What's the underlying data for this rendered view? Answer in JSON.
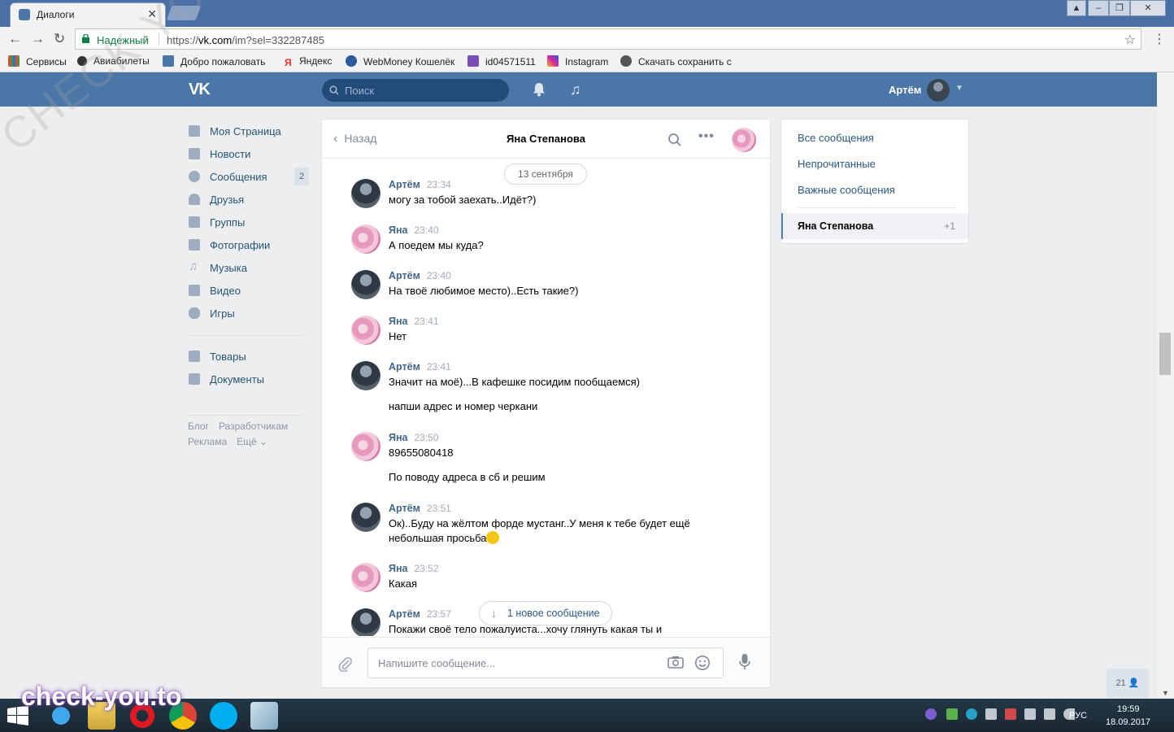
{
  "browser": {
    "tab_title": "Диалоги",
    "tab_close": "✕",
    "secure_label": "Надежный",
    "url_scheme": "https://",
    "url_host": "vk.com",
    "url_path": "/im?sel=332287485",
    "bookmarks": [
      "Сервисы",
      "Авиабилеты",
      "Добро пожаловать",
      "Яндекс",
      "WebMoney Кошелёк",
      "id04571511",
      "Instagram",
      "Скачать сохранить с"
    ]
  },
  "header": {
    "logo": "VK",
    "search_placeholder": "Поиск",
    "user_name": "Артём"
  },
  "nav": {
    "items": [
      {
        "label": "Моя Страница",
        "icon": "home-icon"
      },
      {
        "label": "Новости",
        "icon": "news-icon"
      },
      {
        "label": "Сообщения",
        "icon": "messages-icon",
        "badge": "2"
      },
      {
        "label": "Друзья",
        "icon": "friends-icon"
      },
      {
        "label": "Группы",
        "icon": "groups-icon"
      },
      {
        "label": "Фотографии",
        "icon": "photos-icon"
      },
      {
        "label": "Музыка",
        "icon": "music-icon"
      },
      {
        "label": "Видео",
        "icon": "video-icon"
      },
      {
        "label": "Игры",
        "icon": "games-icon"
      }
    ],
    "secondary": [
      {
        "label": "Товары",
        "icon": "market-icon"
      },
      {
        "label": "Документы",
        "icon": "documents-icon"
      }
    ],
    "footer": [
      "Блог",
      "Разработчикам",
      "Реклама",
      "Ещё ⌄"
    ]
  },
  "chat": {
    "back_label": "Назад",
    "title": "Яна Степанова",
    "date_divider": "13 сентября",
    "messages": [
      {
        "author": "Артём",
        "time": "23:34",
        "avatar": "artem",
        "lines": [
          "могу за тобой заехать..Идёт?)"
        ]
      },
      {
        "author": "Яна",
        "time": "23:40",
        "avatar": "yana",
        "lines": [
          "А поедем мы куда?"
        ]
      },
      {
        "author": "Артём",
        "time": "23:40",
        "avatar": "artem",
        "lines": [
          "На твоё любимое место)..Есть такие?)"
        ]
      },
      {
        "author": "Яна",
        "time": "23:41",
        "avatar": "yana",
        "lines": [
          "Нет"
        ]
      },
      {
        "author": "Артём",
        "time": "23:41",
        "avatar": "artem",
        "lines": [
          "Значит на моё)...В кафешке посидим пообщаемся)",
          "напши адрес и номер черкани"
        ]
      },
      {
        "author": "Яна",
        "time": "23:50",
        "avatar": "yana",
        "lines": [
          "89655080418",
          "По поводу адреса в сб и решим"
        ]
      },
      {
        "author": "Артём",
        "time": "23:51",
        "avatar": "artem",
        "lines": [
          "Ок)..Буду на жёлтом форде мустанг..У меня к тебе будет ещё небольшая просьба"
        ]
      },
      {
        "author": "Яна",
        "time": "23:52",
        "avatar": "yana",
        "lines": [
          "Какая"
        ]
      },
      {
        "author": "Артём",
        "time": "23:57",
        "avatar": "artem",
        "lines": [
          "Покажи своё тело пожалуиста...хочу глянуть какая ты и"
        ]
      }
    ],
    "new_message_label": "1 новое сообщение",
    "composer_placeholder": "Напишите сообщение..."
  },
  "filters": {
    "items": [
      "Все сообщения",
      "Непрочитанные",
      "Важные сообщения"
    ],
    "active_label": "Яна Степанова",
    "active_count": "+1"
  },
  "online_widget": "21",
  "taskbar": {
    "lang": "РУС",
    "time": "19:59",
    "date": "18.09.2017"
  },
  "watermarks": {
    "diagonal": "CHECK-YOU.ME",
    "site": "check-you.to"
  },
  "colors": {
    "vk_blue": "#4a76a8",
    "link": "#2a5885",
    "author": "#42648b",
    "background": "#edeef0"
  }
}
